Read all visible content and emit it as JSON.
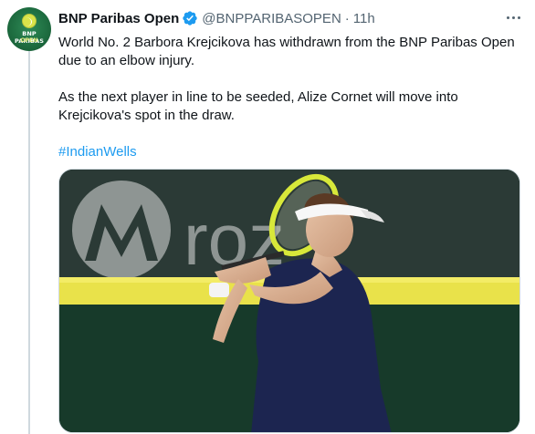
{
  "tweet": {
    "author": {
      "display_name": "BNP Paribas Open",
      "handle": "@BNPPARIBASOPEN",
      "verified": true,
      "avatar": {
        "line1": "BNP PARIBAS",
        "line2": "OPEN"
      }
    },
    "separator": "·",
    "timestamp": "11h",
    "more_icon": "more-horizontal-icon",
    "text": {
      "paragraph1": "World No. 2 Barbora Krejcikova has withdrawn from the BNP Paribas Open due to an elbow injury.",
      "paragraph2": "As the next player in line to be seeded, Alize Cornet will move into Krejcikova's spot in the draw.",
      "hashtag": "#IndianWells"
    },
    "media": {
      "alt": "Tennis player in navy dress and white visor swinging a yellow racquet",
      "banner_text": "roz"
    }
  },
  "colors": {
    "text_primary": "#0f1419",
    "text_secondary": "#536471",
    "link": "#1d9bf0",
    "verified_badge": "#1d9bf0",
    "avatar_green": "#1d6b3f",
    "border": "#cfd9de"
  }
}
